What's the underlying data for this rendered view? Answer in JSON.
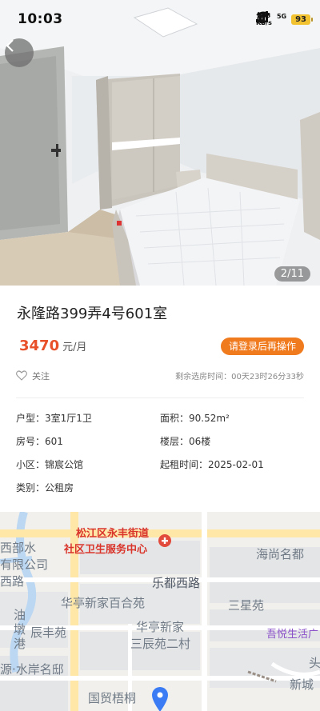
{
  "status_bar": {
    "time": "10:03",
    "speed_value": "533",
    "speed_unit": "KB/s",
    "network": "5G",
    "battery": "93"
  },
  "gallery": {
    "counter": "2/11"
  },
  "listing": {
    "title": "永隆路399弄4号601室",
    "price": "3470",
    "price_unit": "元/月",
    "login_button": "请登录后再操作",
    "follow_label": "关注",
    "countdown": "剩余选房时间：00天23时26分33秒",
    "attributes": [
      {
        "label": "户型：",
        "value": "3室1厅1卫"
      },
      {
        "label": "面积：",
        "value": "90.52m²"
      },
      {
        "label": "房号：",
        "value": "601"
      },
      {
        "label": "楼层：",
        "value": "06楼"
      },
      {
        "label": "小区：",
        "value": "锦宸公馆"
      },
      {
        "label": "起租时间：",
        "value": "2025-02-01"
      },
      {
        "label": "类别：",
        "value": "公租房"
      }
    ]
  },
  "map": {
    "labels": {
      "road_top": "松江区永丰街道",
      "clinic": "社区卫生服务中心",
      "west_a": "西部水",
      "west_b": "有限公司",
      "west_road": "西路",
      "lecai_road": "乐都西路",
      "haishang": "海尚名都",
      "baihe": "华亭新家百合苑",
      "sanxing": "三星苑",
      "you": "油",
      "dun": "墩",
      "gang": "港",
      "chenfeng": "辰丰苑",
      "huating": "华亭新家",
      "sanchen": "三辰苑二村",
      "wuyue": "吾悦生活广",
      "shuian": "源·水岸名邸",
      "xincheng": "新城",
      "guomao": "国贸梧桐",
      "right_edge": "头"
    },
    "colors": {
      "road": "#ffffff",
      "major_road": "#ffe7a8",
      "water": "#bcd7f2",
      "block": "#e4e5e7",
      "pin": "#3b7cf5"
    }
  }
}
